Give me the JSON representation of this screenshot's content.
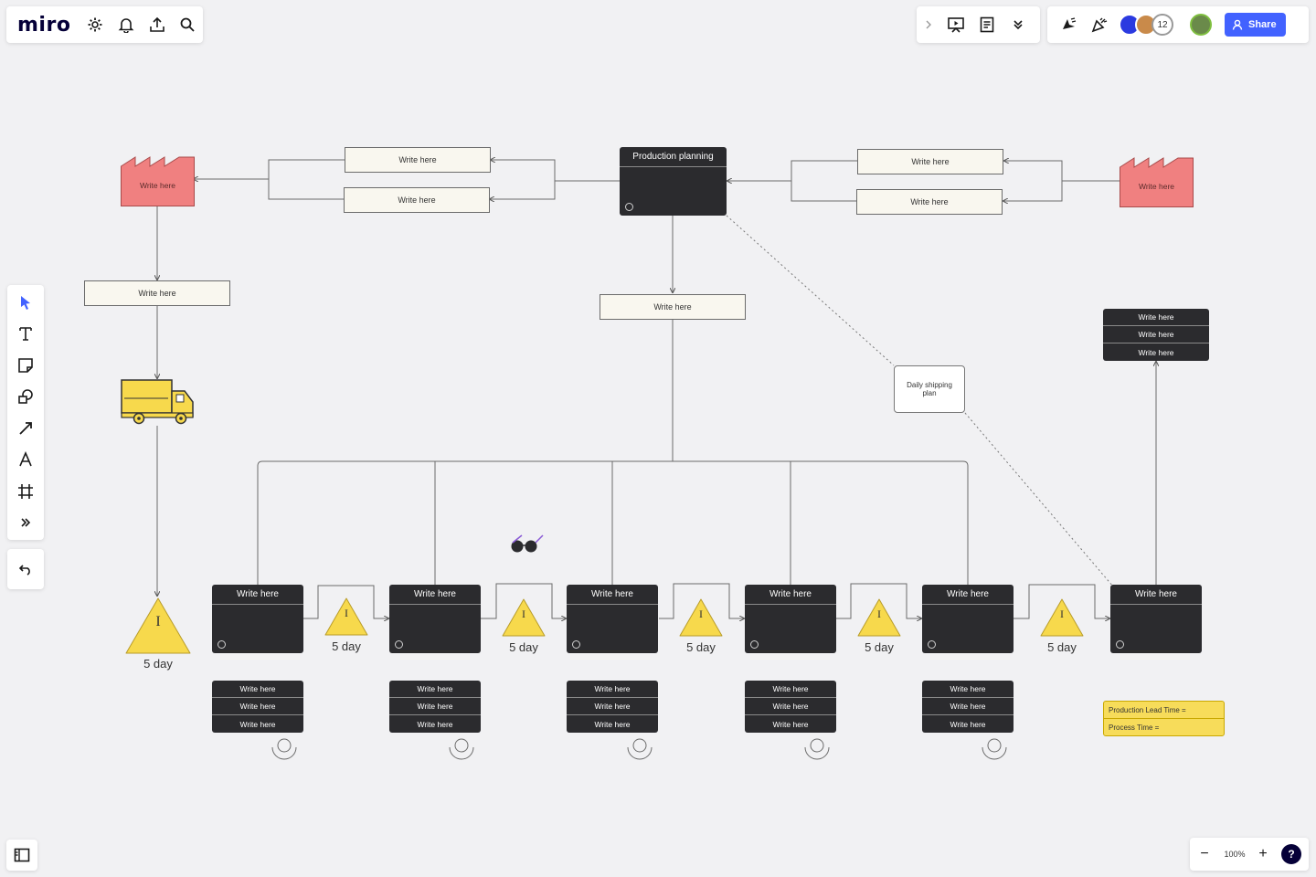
{
  "app": {
    "logo": "miro"
  },
  "topbar": {
    "share_label": "Share",
    "collaborators_count": "12"
  },
  "zoom": {
    "level": "100%",
    "minus": "−",
    "plus": "+",
    "help": "?"
  },
  "board": {
    "planning_title": "Production planning",
    "supplier_label": "Write here",
    "customer_label": "Write here",
    "supplier_info_top": "Write here",
    "supplier_info_bottom": "Write here",
    "customer_info_top": "Write here",
    "customer_info_bottom": "Write here",
    "shipping_schedule": "Write here",
    "schedule_center": "Write here",
    "daily_shipping": "Daily shipping plan",
    "shipping_stack": [
      "Write here",
      "Write here",
      "Write here"
    ],
    "processes": [
      {
        "title": "Write here",
        "data": [
          "Write here",
          "Write here",
          "Write here"
        ]
      },
      {
        "title": "Write here",
        "data": [
          "Write here",
          "Write here",
          "Write here"
        ]
      },
      {
        "title": "Write here",
        "data": [
          "Write here",
          "Write here",
          "Write here"
        ]
      },
      {
        "title": "Write here",
        "data": [
          "Write here",
          "Write here",
          "Write here"
        ]
      },
      {
        "title": "Write here",
        "data": [
          "Write here",
          "Write here",
          "Write here"
        ]
      },
      {
        "title": "Write here",
        "data": []
      }
    ],
    "inventory_days": [
      "5 day",
      "5 day",
      "5 day",
      "5 day",
      "5 day",
      "5 day"
    ],
    "inventory_symbol": "I",
    "lead_time": [
      "Production Lead Time =",
      "Process Time ="
    ]
  },
  "colors": {
    "accent": "#4262ff",
    "factory": "#f08080",
    "inventory": "#f7d94c",
    "process": "#2b2b2e",
    "info_box": "#f9f7ef"
  }
}
